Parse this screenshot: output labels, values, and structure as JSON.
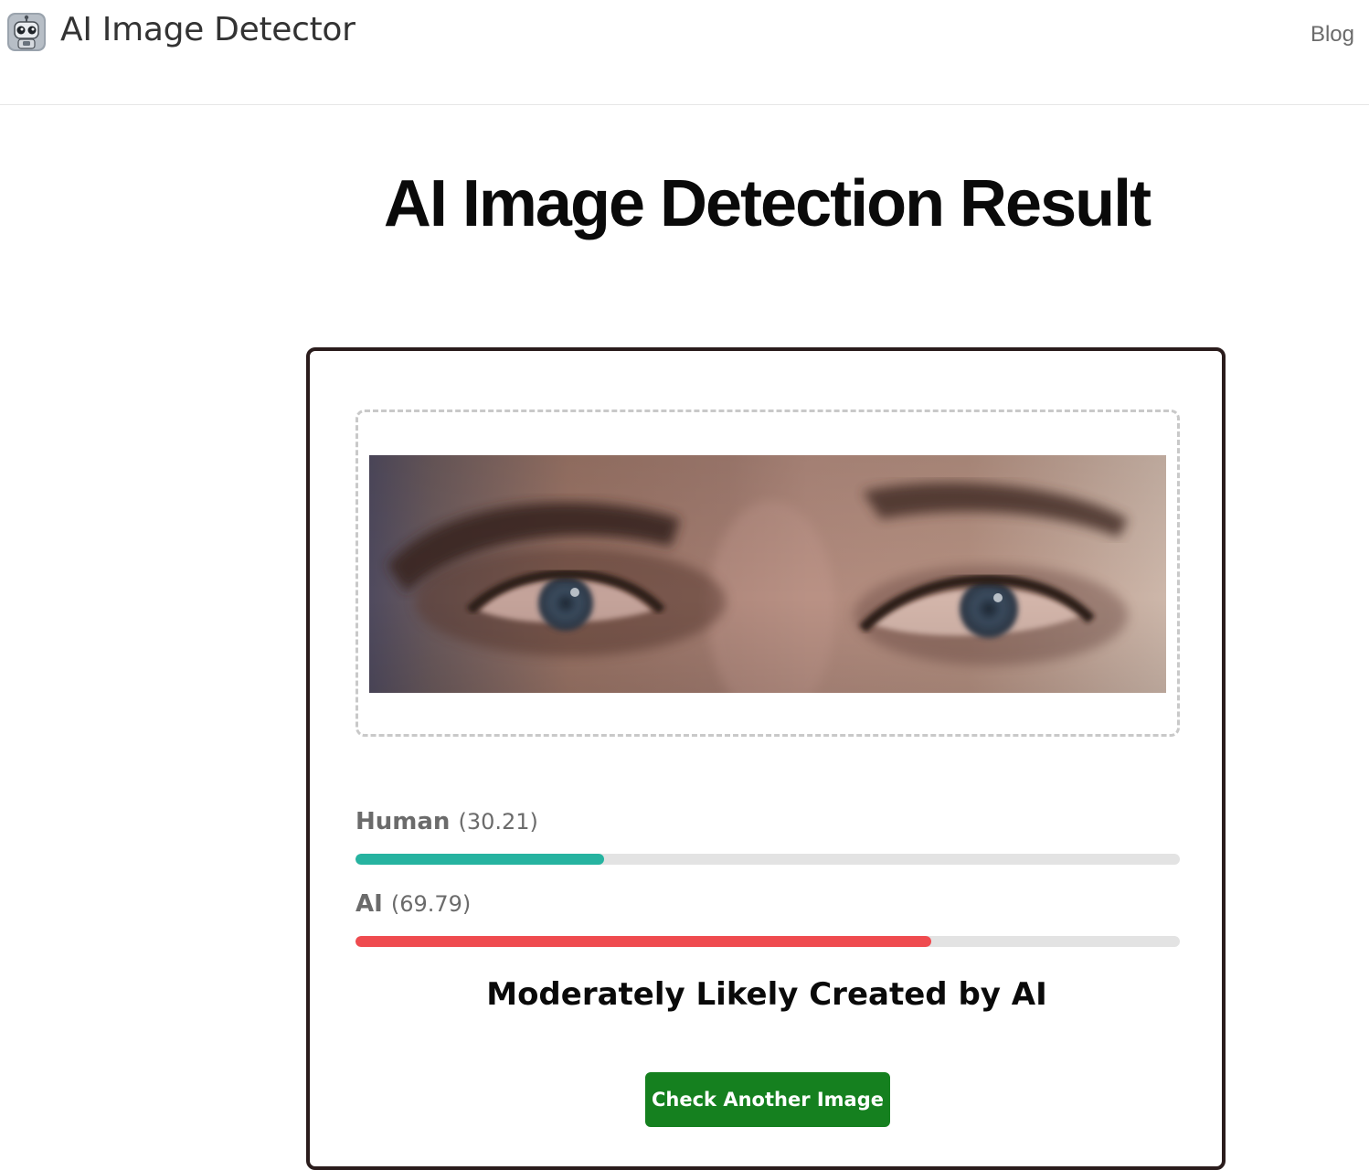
{
  "header": {
    "brand": "AI Image Detector",
    "logo_icon": "robot-icon",
    "nav_blog": "Blog"
  },
  "main": {
    "title": "AI Image Detection Result"
  },
  "result": {
    "image_icon": "uploaded-face-image",
    "human": {
      "label": "Human",
      "score_text": "(30.21)",
      "score": 30.21,
      "color": "#26b3a0"
    },
    "ai": {
      "label": "AI",
      "score_text": "(69.79)",
      "score": 69.79,
      "color": "#ef4b4f"
    },
    "verdict": "Moderately Likely Created by AI",
    "button": "Check Another Image",
    "button_color": "#15801f"
  }
}
